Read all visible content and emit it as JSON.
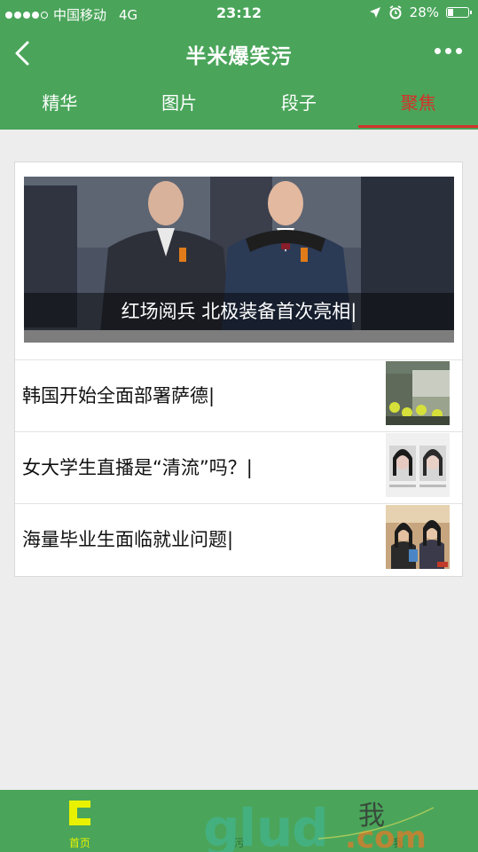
{
  "status_bar": {
    "carrier": "中国移动",
    "network": "4G",
    "time": "23:12",
    "battery": "28%"
  },
  "navbar": {
    "title": "半米爆笑污"
  },
  "tabs": [
    {
      "label": "精华"
    },
    {
      "label": "图片"
    },
    {
      "label": "段子"
    },
    {
      "label": "聚焦"
    }
  ],
  "active_tab": "聚焦",
  "hero": {
    "caption": "红场阅兵 北极装备首次亮相|"
  },
  "news_items": [
    {
      "title": "韩国开始全面部署萨德|"
    },
    {
      "title": "女大学生直播是“清流”吗？|"
    },
    {
      "title": "海量毕业生面临就业问题|"
    }
  ],
  "bottom_tabs": [
    {
      "label": "首页"
    },
    {
      "label": "污"
    },
    {
      "label": "我"
    }
  ],
  "watermark": {
    "text": "我.com"
  },
  "colors": {
    "primary_green": "#4aa55a",
    "active_red": "#d3322a",
    "home_yellow": "#e8f200",
    "background": "#ededed"
  }
}
